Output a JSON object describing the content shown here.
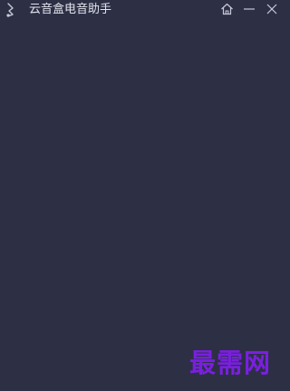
{
  "titlebar": {
    "title": "云音盒电音助手",
    "logo_icon": "music-note-icon",
    "controls": [
      {
        "name": "home",
        "icon": "home-icon"
      },
      {
        "name": "minimize",
        "icon": "minimize-icon"
      },
      {
        "name": "close",
        "icon": "close-icon"
      }
    ]
  },
  "watermark": {
    "text": "最需网",
    "color": "#7a1fe0"
  },
  "colors": {
    "background": "#2d2f45",
    "title_text": "#e3e4ee",
    "icon_stroke": "#c9cad8"
  }
}
